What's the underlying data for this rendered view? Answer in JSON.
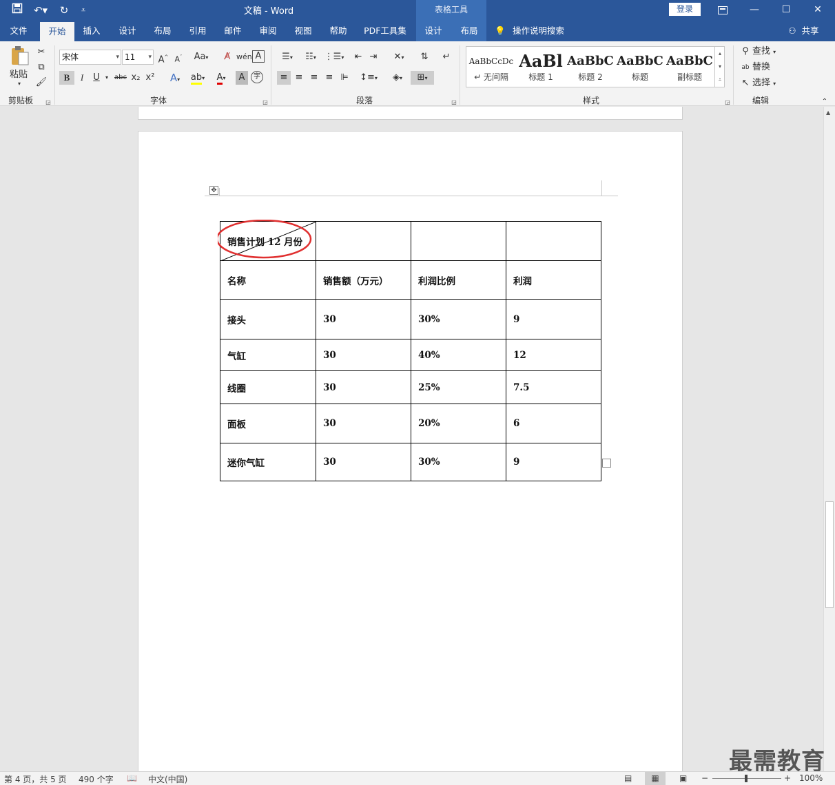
{
  "titlebar": {
    "title": "文稿  -  Word",
    "context_tab_group": "表格工具",
    "login_label": "登录",
    "quick_access": {
      "save": "save-icon",
      "undo": "undo-icon",
      "redo": "redo-icon",
      "customize": "customize-icon"
    },
    "window_controls": {
      "ribbon_display": "ribbon-display-icon",
      "minimize": "minimize-icon",
      "maximize": "maximize-icon",
      "close": "close-icon"
    }
  },
  "tabs": [
    {
      "label": "文件",
      "active": false
    },
    {
      "label": "开始",
      "active": true
    },
    {
      "label": "插入",
      "active": false
    },
    {
      "label": "设计",
      "active": false
    },
    {
      "label": "布局",
      "active": false
    },
    {
      "label": "引用",
      "active": false
    },
    {
      "label": "邮件",
      "active": false
    },
    {
      "label": "审阅",
      "active": false
    },
    {
      "label": "视图",
      "active": false
    },
    {
      "label": "帮助",
      "active": false
    },
    {
      "label": "PDF工具集",
      "active": false
    },
    {
      "label": "设计",
      "active": false
    },
    {
      "label": "布局",
      "active": false
    }
  ],
  "tell_me": "操作说明搜索",
  "share_label": "共享",
  "ribbon": {
    "clipboard": {
      "label": "剪贴板",
      "paste": "粘贴"
    },
    "font": {
      "label": "字体",
      "font_name": "宋体",
      "font_size": "11",
      "change_case": "Aa",
      "bold": "B",
      "italic": "I",
      "underline": "U",
      "strike": "abc",
      "subscript": "x₂",
      "superscript": "x²"
    },
    "paragraph": {
      "label": "段落"
    },
    "styles": {
      "label": "样式",
      "items": [
        {
          "sample": "AaBbCcDc",
          "name": "↵ 无间隔"
        },
        {
          "sample": "AaBl",
          "name": "标题 1"
        },
        {
          "sample": "AaBbC",
          "name": "标题 2"
        },
        {
          "sample": "AaBbC",
          "name": "标题"
        },
        {
          "sample": "AaBbC",
          "name": "副标题"
        }
      ]
    },
    "editing": {
      "label": "编辑",
      "find": "查找",
      "replace": "替换",
      "select": "选择"
    }
  },
  "table": {
    "header_diagonal": "销售计划 12 月份",
    "columns": [
      "名称",
      "销售额（万元）",
      "利润比例",
      "利润"
    ],
    "rows": [
      [
        "接头",
        "30",
        "30%",
        "9"
      ],
      [
        "气缸",
        "30",
        "40%",
        "12"
      ],
      [
        "线圈",
        "30",
        "25%",
        "7.5"
      ],
      [
        "面板",
        "30",
        "20%",
        "6"
      ],
      [
        "迷你气缸",
        "30",
        "30%",
        "9"
      ]
    ],
    "highlight_color": "#e03030"
  },
  "status": {
    "page": "第 4 页，共 5 页",
    "words": "490 个字",
    "language": "中文(中国)",
    "zoom": "100%"
  },
  "watermark": "最需教育",
  "colors": {
    "accent": "#2b579a"
  }
}
